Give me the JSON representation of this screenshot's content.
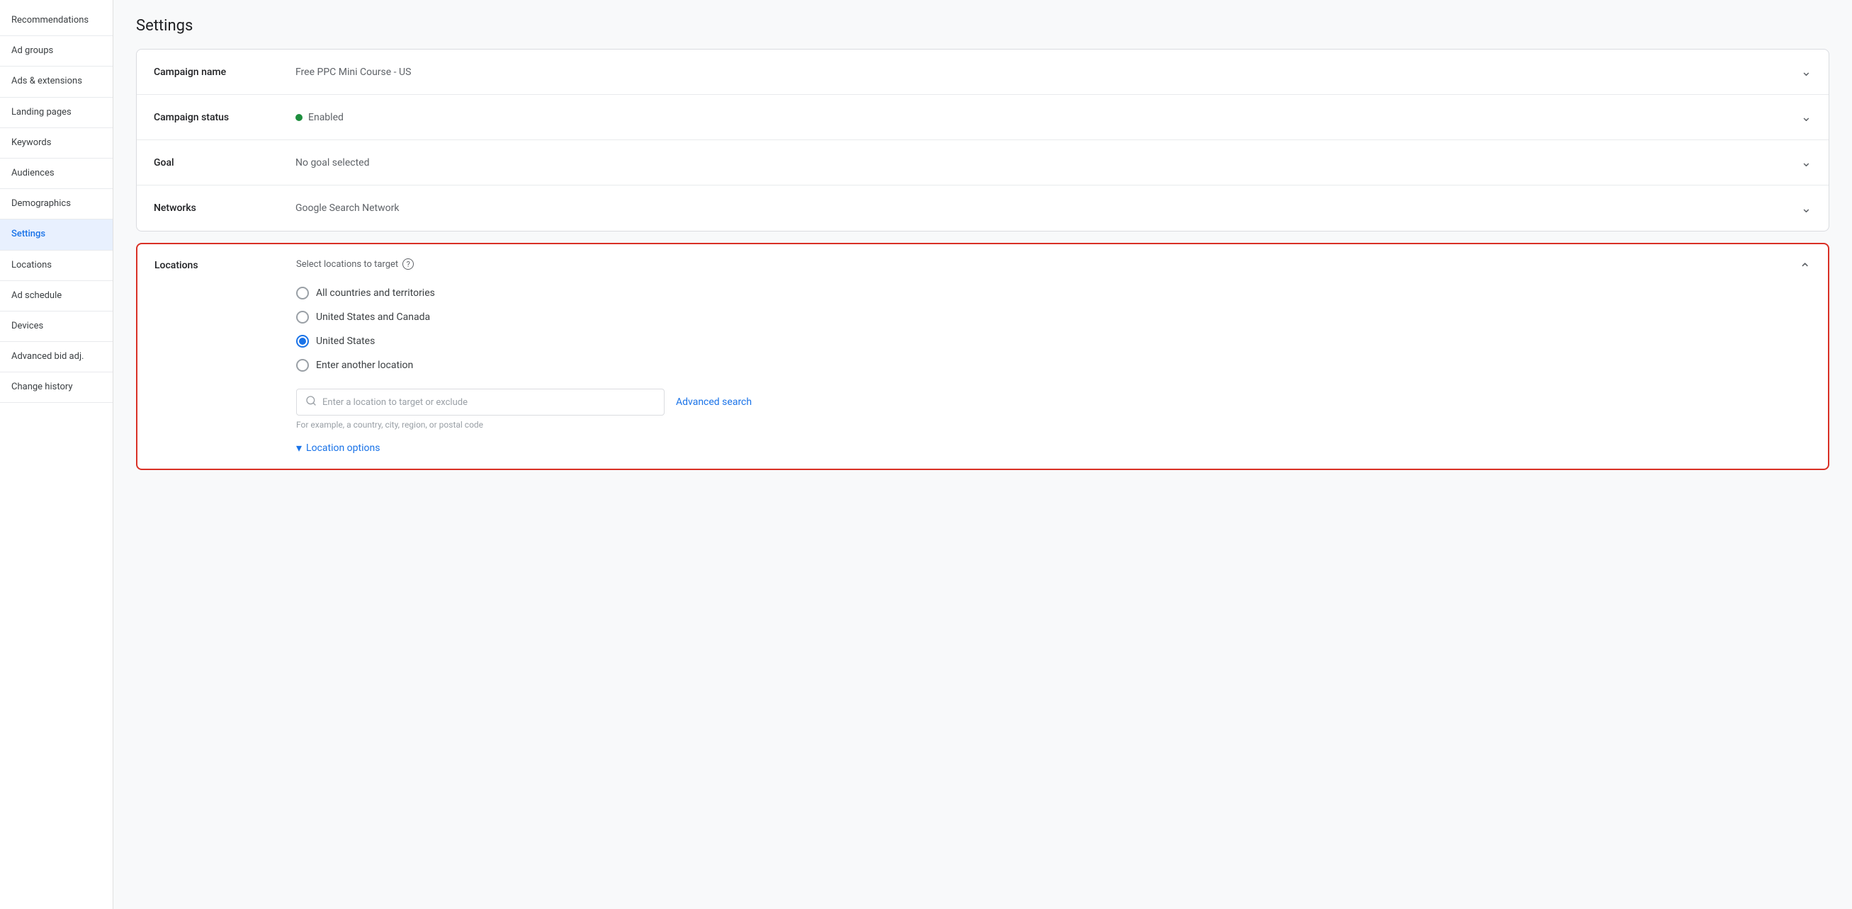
{
  "page": {
    "title": "Settings"
  },
  "sidebar": {
    "items": [
      {
        "id": "recommendations",
        "label": "Recommendations",
        "active": false
      },
      {
        "id": "ad-groups",
        "label": "Ad groups",
        "active": false
      },
      {
        "id": "ads-extensions",
        "label": "Ads & extensions",
        "active": false
      },
      {
        "id": "landing-pages",
        "label": "Landing pages",
        "active": false
      },
      {
        "id": "keywords",
        "label": "Keywords",
        "active": false
      },
      {
        "id": "audiences",
        "label": "Audiences",
        "active": false
      },
      {
        "id": "demographics",
        "label": "Demographics",
        "active": false
      },
      {
        "id": "settings",
        "label": "Settings",
        "active": true
      },
      {
        "id": "locations",
        "label": "Locations",
        "active": false
      },
      {
        "id": "ad-schedule",
        "label": "Ad schedule",
        "active": false
      },
      {
        "id": "devices",
        "label": "Devices",
        "active": false
      },
      {
        "id": "advanced-bid-adj",
        "label": "Advanced bid adj.",
        "active": false
      },
      {
        "id": "change-history",
        "label": "Change history",
        "active": false
      }
    ]
  },
  "settings": {
    "campaign_name_label": "Campaign name",
    "campaign_name_value": "Free PPC Mini Course - US",
    "campaign_status_label": "Campaign status",
    "campaign_status_value": "Enabled",
    "goal_label": "Goal",
    "goal_value": "No goal selected",
    "networks_label": "Networks",
    "networks_value": "Google Search Network"
  },
  "locations_section": {
    "label": "Locations",
    "subtitle": "Select locations to target",
    "help_icon": "?",
    "radio_options": [
      {
        "id": "all-countries",
        "label": "All countries and territories",
        "selected": false
      },
      {
        "id": "us-canada",
        "label": "United States and Canada",
        "selected": false
      },
      {
        "id": "united-states",
        "label": "United States",
        "selected": true
      },
      {
        "id": "another-location",
        "label": "Enter another location",
        "selected": false
      }
    ],
    "search_placeholder": "Enter a location to target or exclude",
    "search_hint": "For example, a country, city, region, or postal code",
    "advanced_search_label": "Advanced search",
    "location_options_label": "Location options",
    "chevron_down": "▾",
    "chevron_up": "∧"
  }
}
